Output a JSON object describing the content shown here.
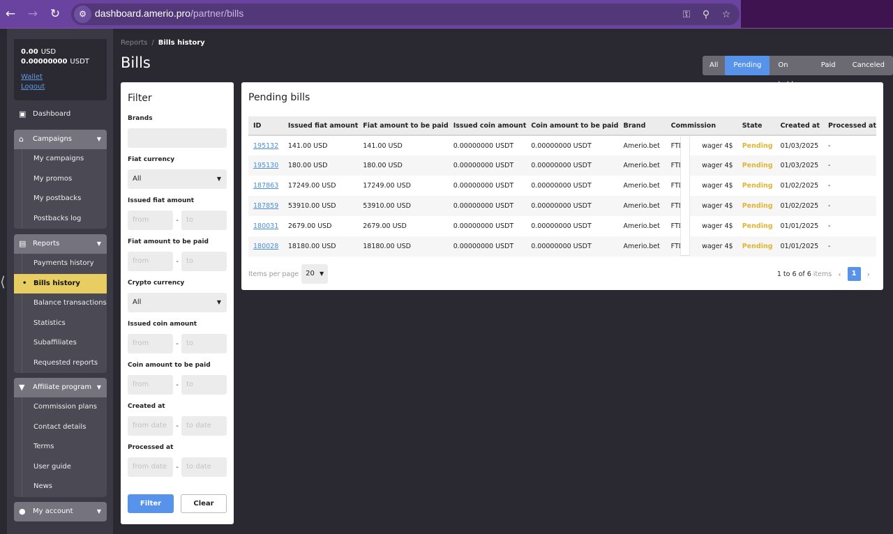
{
  "browser": {
    "url_host": "dashboard.amerio.pro",
    "url_path": "/partner/bills",
    "icons": [
      "back-icon",
      "forward-icon",
      "reload-icon",
      "site-settings-icon",
      "password-key-icon",
      "zoom-icon",
      "bookmark-star-icon"
    ]
  },
  "sidebar": {
    "balance": {
      "usd_value": "0.00",
      "usd_currency": "USD",
      "usdt_value": "0.00000000",
      "usdt_currency": "USDT",
      "wallet_link": "Wallet",
      "logout_link": "Logout"
    },
    "dashboard": {
      "label": "Dashboard",
      "icon": "dashboard-icon"
    },
    "groups": [
      {
        "label": "Campaigns",
        "icon": "store-icon",
        "items": [
          {
            "label": "My campaigns"
          },
          {
            "label": "My promos"
          },
          {
            "label": "My postbacks"
          },
          {
            "label": "Postbacks log"
          }
        ]
      },
      {
        "label": "Reports",
        "icon": "clipboard-icon",
        "items": [
          {
            "label": "Payments history"
          },
          {
            "label": "Bills history",
            "active": true
          },
          {
            "label": "Balance transactions"
          },
          {
            "label": "Statistics"
          },
          {
            "label": "Subaffiliates"
          },
          {
            "label": "Requested reports"
          }
        ]
      },
      {
        "label": "Affiliate program",
        "icon": "diamond-icon",
        "items": [
          {
            "label": "Commission plans"
          },
          {
            "label": "Contact details"
          },
          {
            "label": "Terms"
          },
          {
            "label": "User guide"
          },
          {
            "label": "News"
          }
        ]
      },
      {
        "label": "My account",
        "icon": "user-icon",
        "items": []
      }
    ]
  },
  "header": {
    "breadcrumb": [
      "Reports",
      "Bills history"
    ],
    "title": "Bills"
  },
  "state_tabs": [
    {
      "label": "All"
    },
    {
      "label": "Pending",
      "active": true
    },
    {
      "label": "On hold"
    },
    {
      "label": "Paid"
    },
    {
      "label": "Canceled"
    }
  ],
  "filter": {
    "title": "Filter",
    "brands_label": "Brands",
    "brands_value": "",
    "fiat_currency_label": "Fiat currency",
    "fiat_currency_value": "All",
    "issued_fiat_label": "Issued fiat amount",
    "fiat_to_pay_label": "Fiat amount to be paid",
    "crypto_currency_label": "Crypto currency",
    "crypto_currency_value": "All",
    "issued_coin_label": "Issued coin amount",
    "coin_to_pay_label": "Coin amount to be paid",
    "created_at_label": "Created at",
    "processed_at_label": "Processed at",
    "from_placeholder": "from",
    "to_placeholder": "to",
    "from_date_placeholder": "from date",
    "to_date_placeholder": "to date",
    "range_separator": "-",
    "filter_button": "Filter",
    "clear_button": "Clear"
  },
  "bills": {
    "title": "Pending bills",
    "columns": [
      "ID",
      "Issued fiat amount",
      "Fiat amount to be paid",
      "Issued coin amount",
      "Coin amount to be paid",
      "Brand",
      "Commission",
      "State",
      "Created at",
      "Processed at"
    ],
    "rows": [
      {
        "id": "195132",
        "issued_fiat": "141.00 USD",
        "fiat_to_pay": "141.00 USD",
        "issued_coin": "0.00000000 USDT",
        "coin_to_pay": "0.00000000 USDT",
        "brand": "Amerio.bet",
        "commission_a": "FTD",
        "commission_b": "wager 4$",
        "state": "Pending",
        "created_at": "01/03/2025",
        "processed_at": "-"
      },
      {
        "id": "195130",
        "issued_fiat": "180.00 USD",
        "fiat_to_pay": "180.00 USD",
        "issued_coin": "0.00000000 USDT",
        "coin_to_pay": "0.00000000 USDT",
        "brand": "Amerio.bet",
        "commission_a": "FTD",
        "commission_b": "wager 4$",
        "state": "Pending",
        "created_at": "01/03/2025",
        "processed_at": "-"
      },
      {
        "id": "187863",
        "issued_fiat": "17249.00 USD",
        "fiat_to_pay": "17249.00 USD",
        "issued_coin": "0.00000000 USDT",
        "coin_to_pay": "0.00000000 USDT",
        "brand": "Amerio.bet",
        "commission_a": "FTD",
        "commission_b": "wager 4$",
        "state": "Pending",
        "created_at": "01/02/2025",
        "processed_at": "-"
      },
      {
        "id": "187859",
        "issued_fiat": "53910.00 USD",
        "fiat_to_pay": "53910.00 USD",
        "issued_coin": "0.00000000 USDT",
        "coin_to_pay": "0.00000000 USDT",
        "brand": "Amerio.bet",
        "commission_a": "FTD",
        "commission_b": "wager 4$",
        "state": "Pending",
        "created_at": "01/02/2025",
        "processed_at": "-"
      },
      {
        "id": "180031",
        "issued_fiat": "2679.00 USD",
        "fiat_to_pay": "2679.00 USD",
        "issued_coin": "0.00000000 USDT",
        "coin_to_pay": "0.00000000 USDT",
        "brand": "Amerio.bet",
        "commission_a": "FTD",
        "commission_b": "wager 4$",
        "state": "Pending",
        "created_at": "01/01/2025",
        "processed_at": "-"
      },
      {
        "id": "180028",
        "issued_fiat": "18180.00 USD",
        "fiat_to_pay": "18180.00 USD",
        "issued_coin": "0.00000000 USDT",
        "coin_to_pay": "0.00000000 USDT",
        "brand": "Amerio.bet",
        "commission_a": "FTD",
        "commission_b": "wager 4$",
        "state": "Pending",
        "created_at": "01/01/2025",
        "processed_at": "-"
      }
    ],
    "items_per_page_label": "Items per page",
    "items_per_page_value": "20",
    "range_text": "1 to 6 of 6",
    "items_word": "items",
    "current_page": "1"
  },
  "colors": {
    "accent_blue": "#5793ea",
    "active_nav_yellow": "#e8cd63",
    "pending_state": "#e0b534",
    "link_blue": "#4a8ee0"
  }
}
